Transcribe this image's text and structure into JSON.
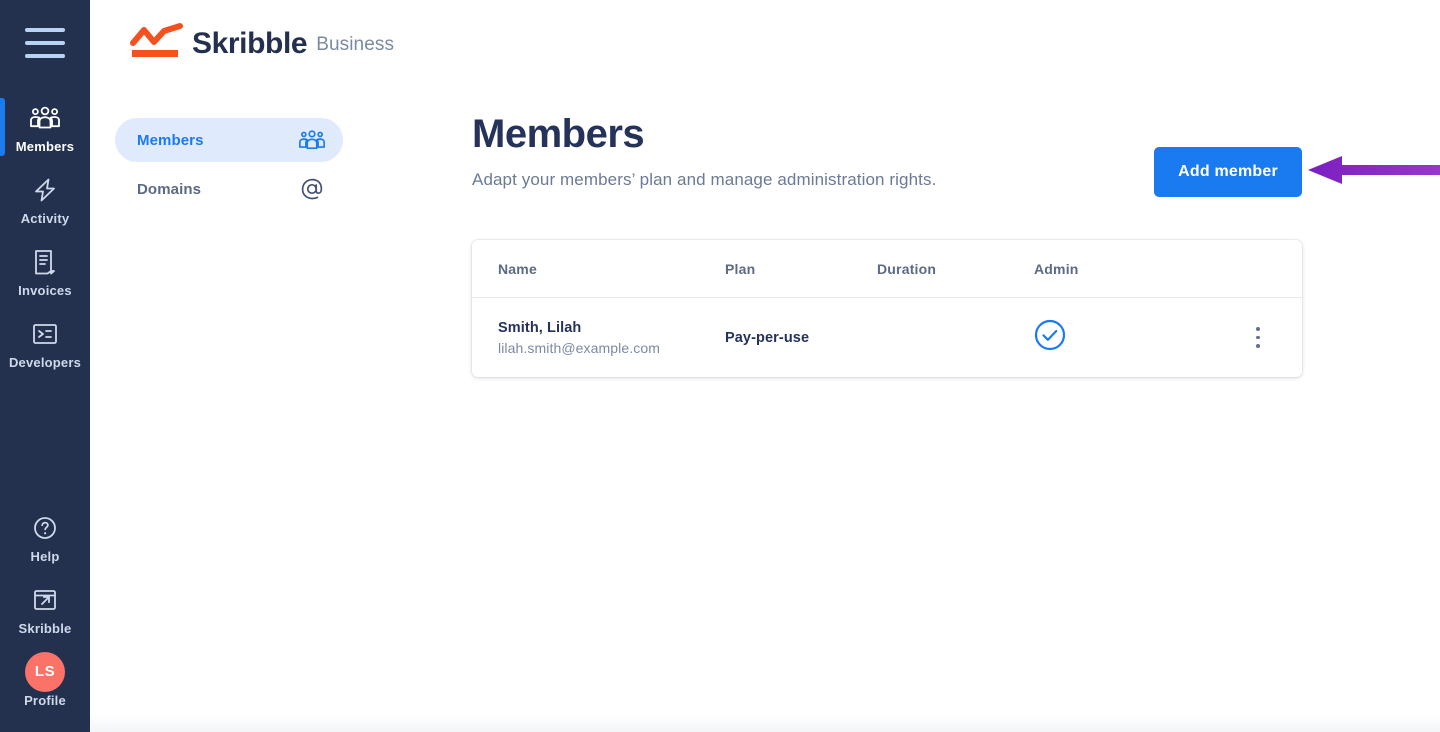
{
  "brand": {
    "logo_icon": "chart-zigzag-logo",
    "name": "Skribble",
    "suffix": "Business",
    "accent_color": "#f4511e",
    "name_color": "#23304e"
  },
  "sidebar": {
    "menu_icon": "hamburger-menu-icon",
    "background_color": "#23304e",
    "active_indicator_color": "#1a7af0",
    "items": [
      {
        "label": "Members",
        "icon": "members-group-icon",
        "active": true
      },
      {
        "label": "Activity",
        "icon": "lightning-bolt-icon",
        "active": false
      },
      {
        "label": "Invoices",
        "icon": "document-lines-icon",
        "active": false
      },
      {
        "label": "Developers",
        "icon": "terminal-prompt-icon",
        "active": false
      }
    ],
    "bottom_items": [
      {
        "label": "Help",
        "icon": "question-circle-icon",
        "active": false
      },
      {
        "label": "Skribble",
        "icon": "external-link-icon",
        "active": false
      },
      {
        "label": "Profile",
        "icon": "avatar-icon",
        "initials": "LS",
        "avatar_color": "#fa7268",
        "active": false
      }
    ]
  },
  "subnav": {
    "items": [
      {
        "label": "Members",
        "icon": "members-group-icon",
        "active": true
      },
      {
        "label": "Domains",
        "icon": "at-sign-icon",
        "active": false
      }
    ],
    "active_bg": "#dfebfc",
    "active_text": "#1a7af0"
  },
  "header": {
    "title": "Members",
    "subtitle": "Adapt your members’ plan and manage administration rights."
  },
  "actions": {
    "add_member_label": "Add member",
    "add_member_color": "#1a7af0"
  },
  "annotation": {
    "arrow": "left-pointing-arrow",
    "color": "#8b2fc9",
    "points_at": "Add member"
  },
  "table": {
    "columns": [
      "Name",
      "Plan",
      "Duration",
      "Admin"
    ],
    "rows": [
      {
        "name": "Smith, Lilah",
        "email": "lilah.smith@example.com",
        "plan": "Pay-per-use",
        "duration": "",
        "admin": true,
        "admin_icon": "check-circle-icon",
        "admin_color": "#1a7af0",
        "menu_icon": "kebab-menu-icon"
      }
    ]
  }
}
